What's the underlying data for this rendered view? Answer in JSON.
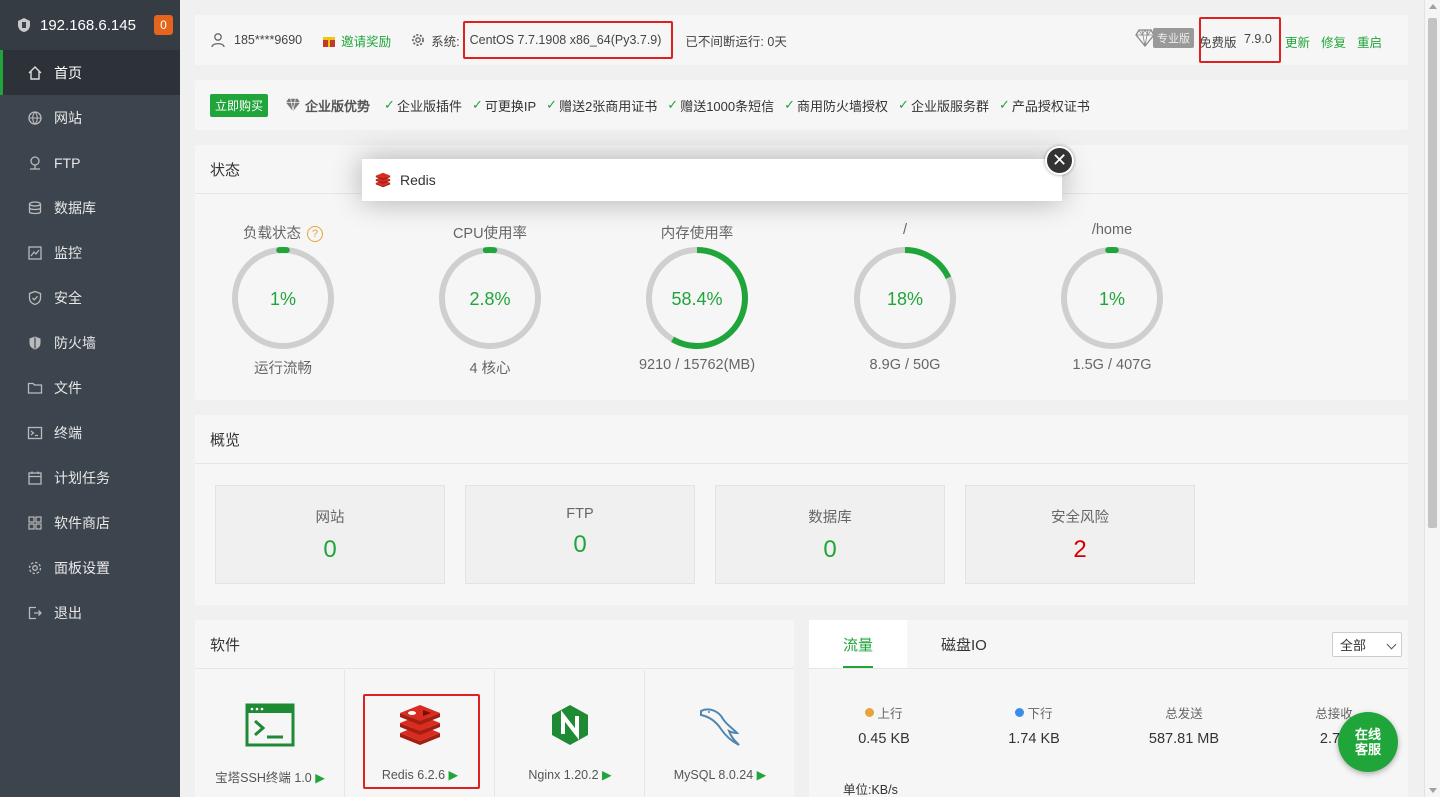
{
  "sidebar": {
    "host": "192.168.6.145",
    "badge": "0",
    "items": [
      {
        "label": "首页",
        "icon": "home-icon"
      },
      {
        "label": "网站",
        "icon": "globe-icon"
      },
      {
        "label": "FTP",
        "icon": "ftp-icon"
      },
      {
        "label": "数据库",
        "icon": "database-icon"
      },
      {
        "label": "监控",
        "icon": "monitor-icon"
      },
      {
        "label": "安全",
        "icon": "shield-check-icon"
      },
      {
        "label": "防火墙",
        "icon": "firewall-icon"
      },
      {
        "label": "文件",
        "icon": "folder-icon"
      },
      {
        "label": "终端",
        "icon": "terminal-icon"
      },
      {
        "label": "计划任务",
        "icon": "calendar-icon"
      },
      {
        "label": "软件商店",
        "icon": "apps-icon"
      },
      {
        "label": "面板设置",
        "icon": "gear-icon"
      },
      {
        "label": "退出",
        "icon": "logout-icon"
      }
    ]
  },
  "topbar": {
    "user": "185****9690",
    "invite": "邀请奖励",
    "system_label": "系统:",
    "system_value": "CentOS 7.7.1908 x86_64(Py3.7.9)",
    "uptime": "已不间断运行: 0天",
    "pro_label": "专业版",
    "edition": "免费版",
    "version": "7.9.0",
    "update": "更新",
    "repair": "修复",
    "restart": "重启"
  },
  "promo": {
    "buy": "立即购买",
    "title": "企业版优势",
    "features": [
      "企业版插件",
      "可更换IP",
      "赠送2张商用证书",
      "赠送1000条短信",
      "商用防火墙授权",
      "企业版服务群",
      "产品授权证书"
    ]
  },
  "status": {
    "title": "状态",
    "gauges": [
      {
        "label": "负载状态",
        "value": "1%",
        "sub": "运行流畅",
        "percent": 1
      },
      {
        "label": "CPU使用率",
        "value": "2.8%",
        "sub": "4 核心",
        "percent": 2.8
      },
      {
        "label": "内存使用率",
        "value": "58.4%",
        "sub": "9210 / 15762(MB)",
        "percent": 58.4
      },
      {
        "label": "/",
        "value": "18%",
        "sub": "8.9G / 50G",
        "percent": 18
      },
      {
        "label": "/home",
        "value": "1%",
        "sub": "1.5G / 407G",
        "percent": 1
      }
    ],
    "help": "?"
  },
  "overview": {
    "title": "概览",
    "cards": [
      {
        "label": "网站",
        "value": "0"
      },
      {
        "label": "FTP",
        "value": "0"
      },
      {
        "label": "数据库",
        "value": "0"
      },
      {
        "label": "安全风险",
        "value": "2"
      }
    ]
  },
  "software": {
    "title": "软件",
    "items": [
      {
        "name": "宝塔SSH终端 1.0",
        "icon": "terminal-app-icon"
      },
      {
        "name": "Redis 6.2.6",
        "icon": "redis-icon"
      },
      {
        "name": "Nginx 1.20.2",
        "icon": "nginx-icon"
      },
      {
        "name": "MySQL 8.0.24",
        "icon": "mysql-icon"
      }
    ]
  },
  "traffic": {
    "tabs": [
      "流量",
      "磁盘IO"
    ],
    "select": "全部",
    "cols": [
      {
        "label": "上行",
        "value": "0.45 KB",
        "dot": "#e8a33a"
      },
      {
        "label": "下行",
        "value": "1.74 KB",
        "dot": "#3a8ee8"
      },
      {
        "label": "总发送",
        "value": "587.81 MB"
      },
      {
        "label": "总接收",
        "value": "2.79"
      }
    ],
    "unit": "单位:KB/s"
  },
  "modal": {
    "title": "Redis"
  },
  "chat": {
    "line1": "在线",
    "line2": "客服"
  },
  "colors": {
    "accent": "#20a53a",
    "sidebar": "#3c444d",
    "danger": "#d40000",
    "highlight_box": "#e02020"
  }
}
